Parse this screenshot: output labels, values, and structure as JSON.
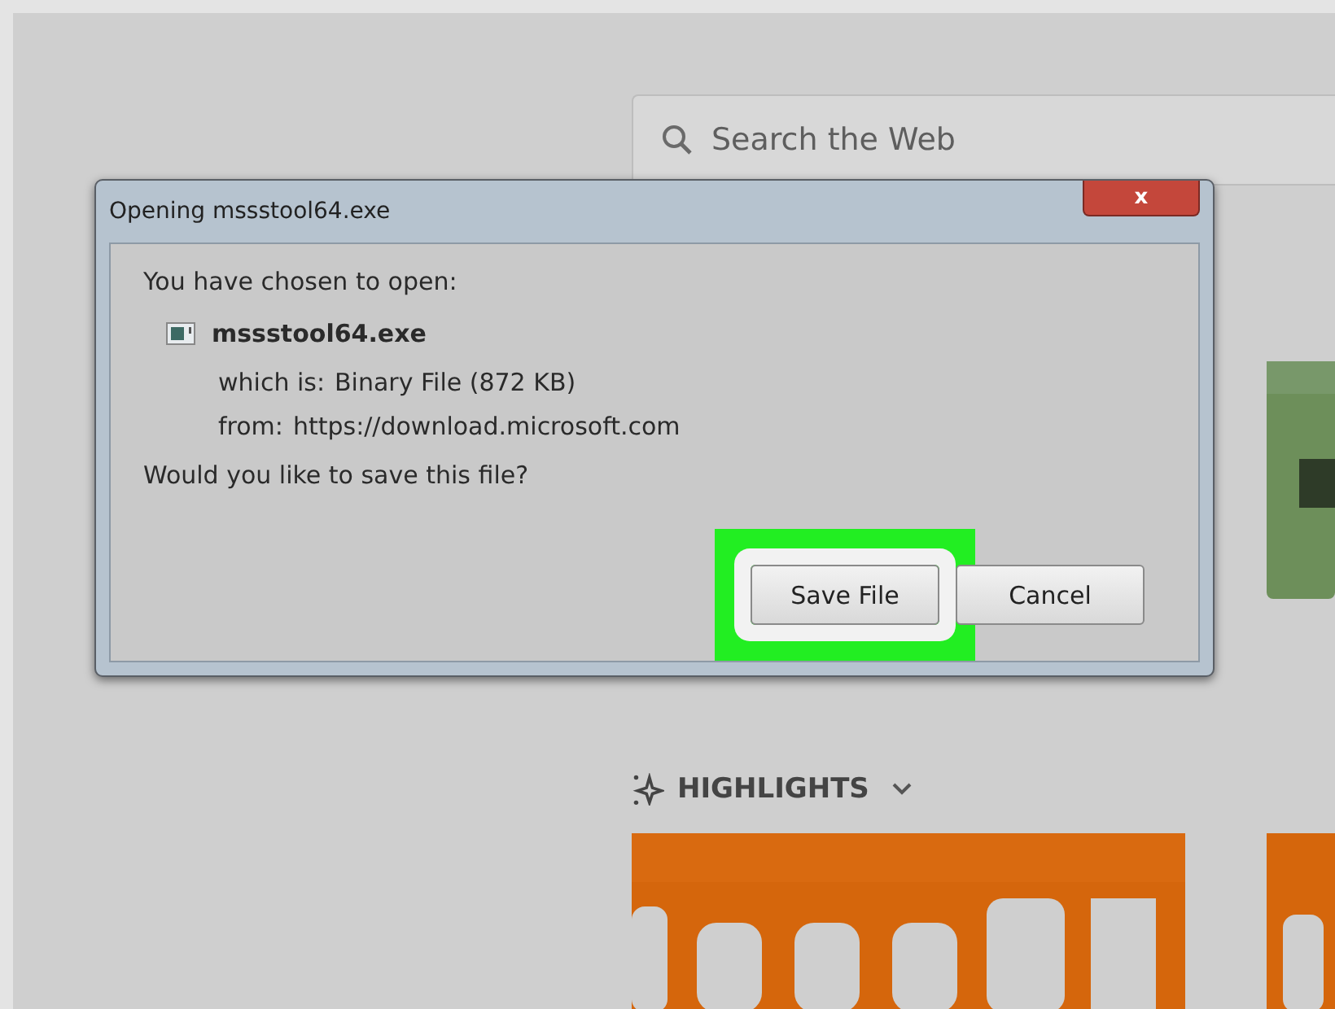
{
  "search": {
    "placeholder": "Search the Web"
  },
  "dialog": {
    "title": "Opening mssstool64.exe",
    "close_label": "x",
    "intro": "You have chosen to open:",
    "file_name": "mssstool64.exe",
    "details": [
      {
        "label": "which is:",
        "value": "Binary File (872 KB)"
      },
      {
        "label": "from:",
        "value": "https://download.microsoft.com"
      }
    ],
    "question": "Would you like to save this file?",
    "buttons": [
      {
        "label": "Save File",
        "highlighted": true
      },
      {
        "label": "Cancel",
        "highlighted": false
      }
    ]
  },
  "highlights": {
    "title": "HIGHLIGHTS"
  }
}
